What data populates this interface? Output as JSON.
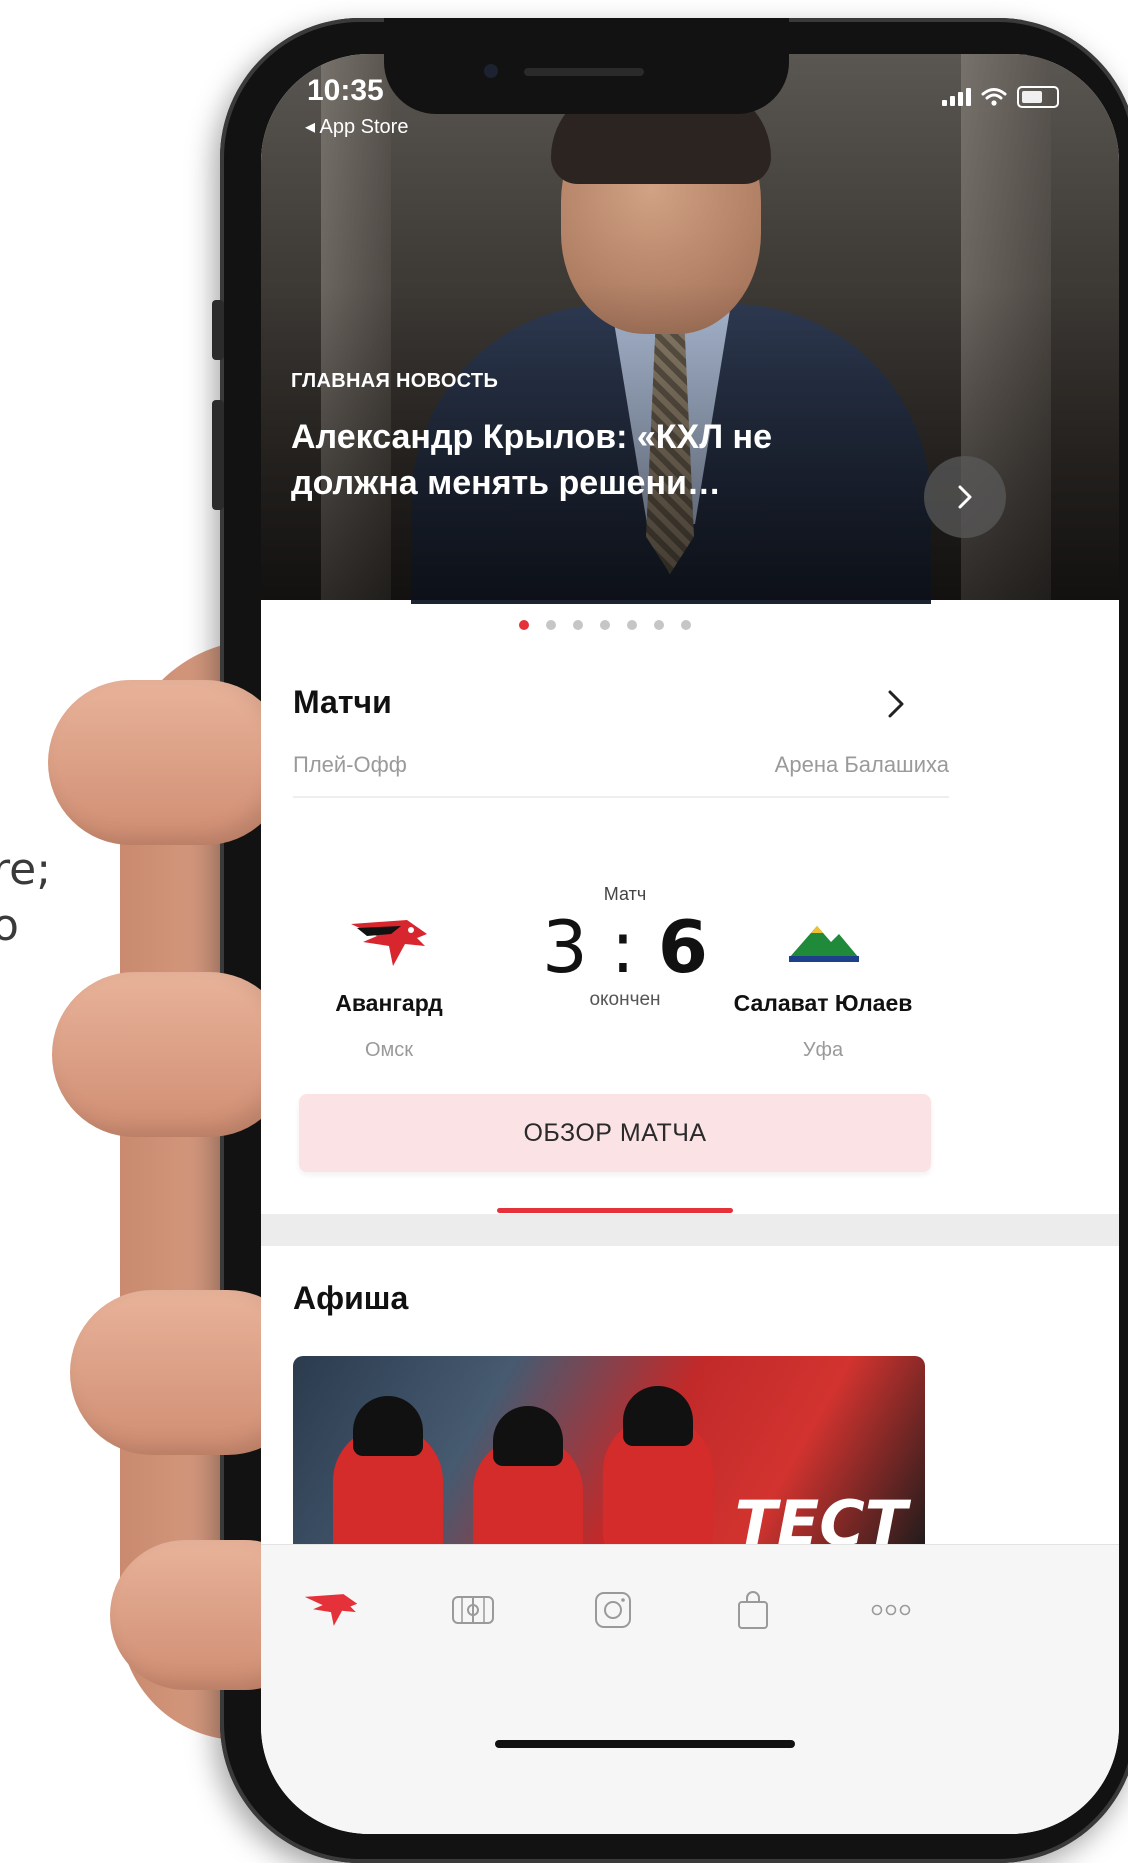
{
  "background": {
    "text_lines": [
      "re;",
      "o"
    ]
  },
  "status_bar": {
    "time": "10:35",
    "back_label": "◂ App Store"
  },
  "hero": {
    "kicker": "ГЛАВНАЯ НОВОСТЬ",
    "title": "Александр Крылов: «КХЛ не должна менять решени…",
    "carousel_count": 7,
    "active_index": 0
  },
  "matches": {
    "title": "Матчи",
    "stage": "Плей-Офф",
    "venue": "Арена Балашиха",
    "center_label": "Матч",
    "home_score": "3",
    "separator": ":",
    "away_score": "6",
    "status": "окончен",
    "home_team": {
      "name": "Авангард",
      "city": "Омск"
    },
    "away_team": {
      "name": "Салават Юлаев",
      "city": "Уфа"
    },
    "review_button": "ОБЗОР МАТЧА"
  },
  "afisha": {
    "title": "Афиша",
    "banner_text": "ТЕСТ"
  },
  "tabbar": {
    "items": [
      {
        "icon": "club-logo-icon",
        "active": true
      },
      {
        "icon": "rink-icon",
        "active": false
      },
      {
        "icon": "instagram-icon",
        "active": false
      },
      {
        "icon": "shop-bag-icon",
        "active": false
      },
      {
        "icon": "more-icon",
        "active": false
      }
    ]
  },
  "colors": {
    "accent": "#e4313a",
    "review_bg": "#fbe3e5",
    "muted": "#9a9a9a"
  }
}
